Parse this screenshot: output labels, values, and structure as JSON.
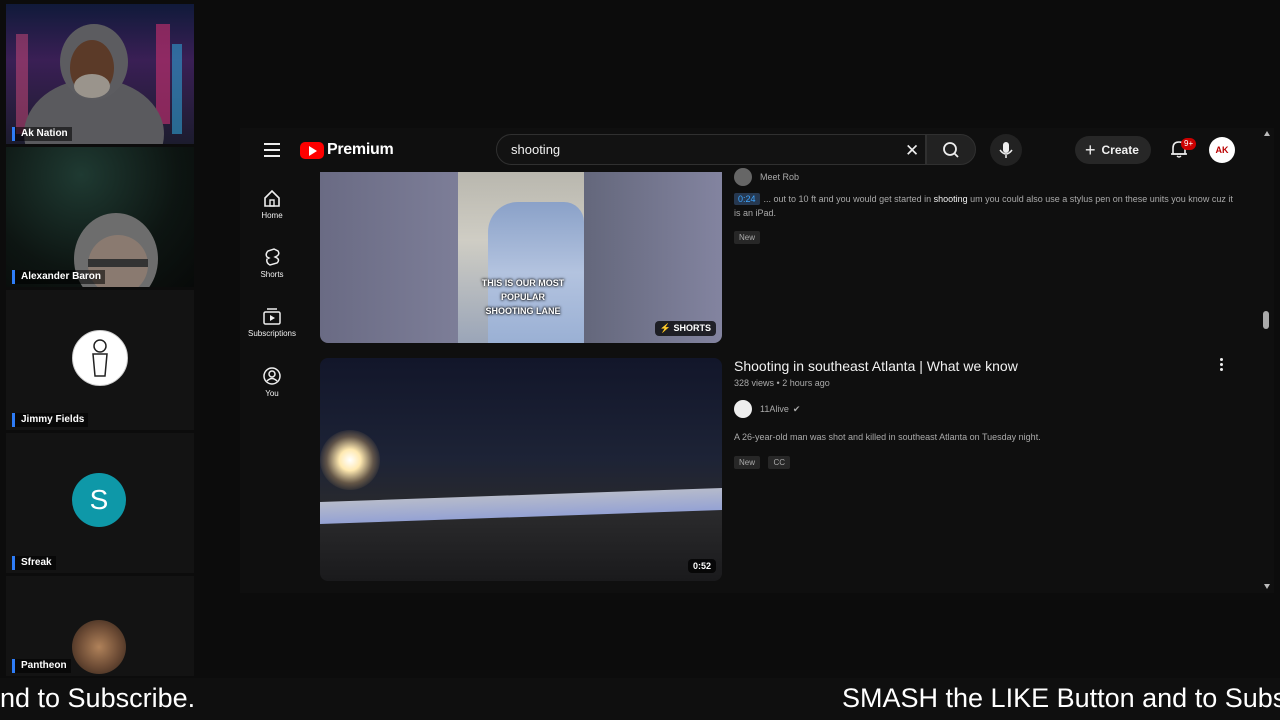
{
  "participants": [
    {
      "name": "Ak Nation"
    },
    {
      "name": "Alexander Baron"
    },
    {
      "name": "Jimmy Fields"
    },
    {
      "name": "Sfreak",
      "initial": "S"
    },
    {
      "name": "Pantheon"
    }
  ],
  "youtube": {
    "logo_text": "Premium",
    "search_value": "shooting",
    "create_label": "Create",
    "notification_badge": "9+",
    "account_initials": "AK",
    "nav": [
      {
        "label": "Home"
      },
      {
        "label": "Shorts"
      },
      {
        "label": "Subscriptions"
      },
      {
        "label": "You"
      }
    ],
    "results": [
      {
        "channel": "Meet Rob",
        "timestamp": "0:24",
        "snippet_before": "... out to 10 ft and you would get started in ",
        "snippet_bold": "shooting",
        "snippet_after": " um you could also use a stylus pen on these units you know cuz it is an iPad.",
        "chips": [
          "New"
        ],
        "thumb_caption_1": "THIS IS OUR MOST POPULAR",
        "thumb_caption_2": "SHOOTING LANE",
        "tag": "SHORTS"
      },
      {
        "title": "Shooting in southeast Atlanta | What we know",
        "views": "328 views",
        "age": "2 hours ago",
        "channel": "11Alive",
        "description": "A 26-year-old man was shot and killed in southeast Atlanta on Tuesday night.",
        "chips": [
          "New",
          "CC"
        ],
        "duration": "0:52"
      }
    ]
  },
  "ticker": {
    "left_text": "nd to Subscribe.",
    "right_text": "SMASH the LIKE Button and to Subs"
  }
}
